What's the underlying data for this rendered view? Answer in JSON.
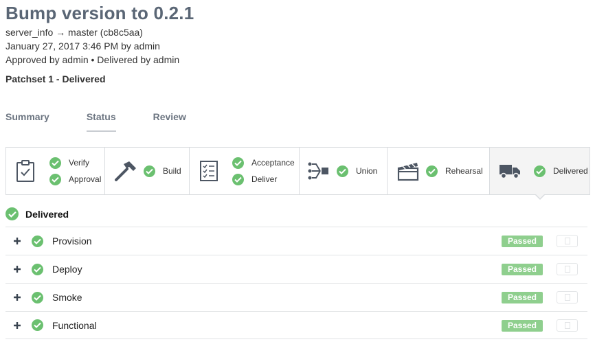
{
  "header": {
    "title": "Bump version to 0.2.1",
    "branch_line": "server_info → master (cb8c5aa)",
    "date_line": "January 27, 2017 3:46 PM by admin",
    "approval_line": "Approved by admin • Delivered by admin",
    "patchset": "Patchset 1 - Delivered"
  },
  "tabs": [
    {
      "label": "Summary",
      "active": false
    },
    {
      "label": "Status",
      "active": true
    },
    {
      "label": "Review",
      "active": false
    }
  ],
  "stages": [
    {
      "icon": "clipboard-check-icon",
      "phases": [
        {
          "label": "Verify",
          "status": "passed"
        },
        {
          "label": "Approval",
          "status": "passed"
        }
      ]
    },
    {
      "icon": "hammer-icon",
      "phases": [
        {
          "label": "Build",
          "status": "passed"
        }
      ]
    },
    {
      "icon": "checklist-icon",
      "phases": [
        {
          "label": "Acceptance",
          "status": "passed"
        },
        {
          "label": "Deliver",
          "status": "passed"
        }
      ]
    },
    {
      "icon": "union-icon",
      "phases": [
        {
          "label": "Union",
          "status": "passed"
        }
      ]
    },
    {
      "icon": "clapperboard-icon",
      "phases": [
        {
          "label": "Rehearsal",
          "status": "passed"
        }
      ]
    },
    {
      "icon": "delivery-truck-icon",
      "phases": [
        {
          "label": "Delivered",
          "status": "passed"
        }
      ],
      "active": true
    }
  ],
  "section": {
    "title": "Delivered"
  },
  "phases": [
    {
      "name": "Provision",
      "status": "Passed"
    },
    {
      "name": "Deploy",
      "status": "Passed"
    },
    {
      "name": "Smoke",
      "status": "Passed"
    },
    {
      "name": "Functional",
      "status": "Passed"
    }
  ],
  "colors": {
    "success": "#6bc070",
    "badge": "#8fcf8e",
    "title": "#5a6675"
  }
}
